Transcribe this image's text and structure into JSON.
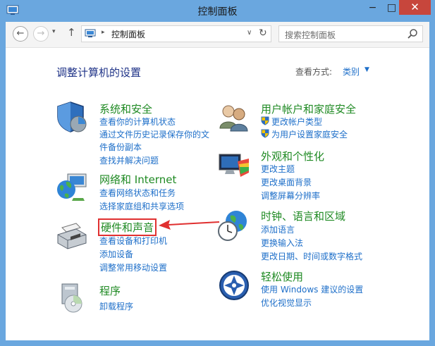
{
  "window": {
    "title": "控制面板",
    "minimize": "−",
    "maximize": "□",
    "close": "✕"
  },
  "toolbar": {
    "back": "←",
    "forward": "→",
    "recent": "▾",
    "up": "↑",
    "address_sep": "▸",
    "address": "控制面板",
    "address_drop": "∨",
    "refresh": "↻",
    "search_placeholder": "搜索控制面板"
  },
  "main": {
    "heading": "调整计算机的设置",
    "view_by_label": "查看方式:",
    "view_by_value": "类别",
    "view_caret": "▼"
  },
  "categories": {
    "system": {
      "title": "系统和安全",
      "links": [
        "查看你的计算机状态",
        "通过文件历史记录保存你的文",
        "件备份副本",
        "查找并解决问题"
      ]
    },
    "network": {
      "title": "网络和 Internet",
      "links": [
        "查看网络状态和任务",
        "选择家庭组和共享选项"
      ]
    },
    "hardware": {
      "title": "硬件和声音",
      "links": [
        "查看设备和打印机",
        "添加设备",
        "调整常用移动设置"
      ]
    },
    "programs": {
      "title": "程序",
      "links": [
        "卸载程序"
      ]
    },
    "users": {
      "title": "用户帐户和家庭安全",
      "links": [
        "更改帐户类型",
        "为用户设置家庭安全"
      ]
    },
    "appearance": {
      "title": "外观和个性化",
      "links": [
        "更改主题",
        "更改桌面背景",
        "调整屏幕分辨率"
      ]
    },
    "clock": {
      "title": "时钟、语言和区域",
      "links": [
        "添加语言",
        "更换输入法",
        "更改日期、时间或数字格式"
      ]
    },
    "ease": {
      "title": "轻松使用",
      "links": [
        "使用 Windows 建议的设置",
        "优化视觉显示"
      ]
    }
  },
  "colors": {
    "title_bar": "#6aa7df",
    "category_title": "#1f8a23",
    "link": "#1e6fc9",
    "heading": "#1e3287",
    "highlight": "#e03030"
  }
}
